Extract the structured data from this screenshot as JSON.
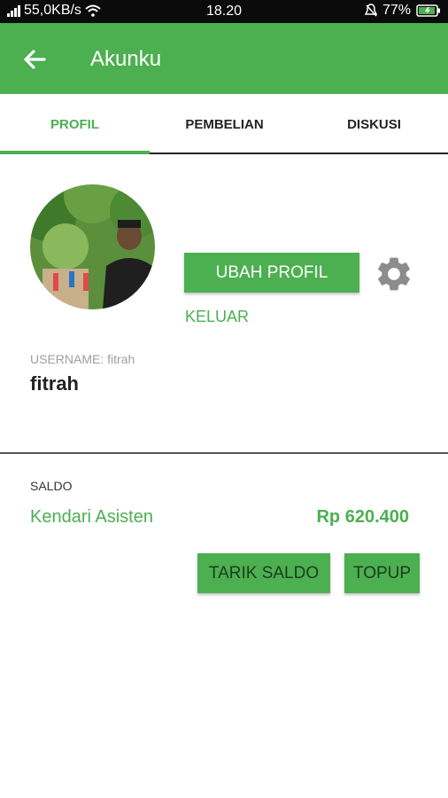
{
  "status_bar": {
    "speed": "55,0KB/s",
    "time": "18.20",
    "battery": "77%",
    "icons": [
      "signal-icon",
      "wifi-icon",
      "alarm-icon",
      "battery-icon"
    ]
  },
  "app_bar": {
    "title": "Akunku",
    "back_icon": "arrow-left-icon",
    "color": "#4caf50"
  },
  "tabs": [
    {
      "label": "PROFIL",
      "active": true
    },
    {
      "label": "PEMBELIAN",
      "active": false
    },
    {
      "label": "DISKUSI",
      "active": false
    }
  ],
  "profile": {
    "edit_label": "UBAH PROFIL",
    "settings_icon": "gear-icon",
    "logout_label": "KELUAR",
    "username_label": "USERNAME: fitrah",
    "username": "fitrah"
  },
  "saldo": {
    "label": "SALDO",
    "account_name": "Kendari Asisten",
    "amount": "Rp 620.400",
    "withdraw_label": "TARIK SALDO",
    "topup_label": "TOPUP"
  }
}
